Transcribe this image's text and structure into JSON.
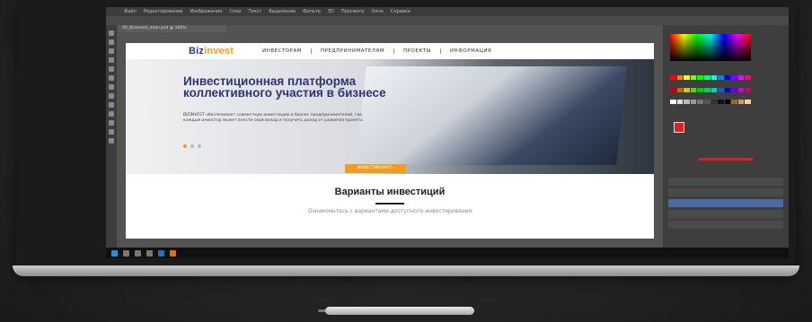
{
  "photoshop": {
    "menu_items": [
      "Файл",
      "Редактирование",
      "Изображение",
      "Слои",
      "Текст",
      "Выделение",
      "Фильтр",
      "3D",
      "Просмотр",
      "Окно",
      "Справка"
    ],
    "doc_tab": "00_Bizinvest_main.psd @ 100%"
  },
  "website": {
    "logo_main": "Biz",
    "logo_accent": "invest",
    "nav_items": [
      "ИНВЕСТОРАМ",
      "ПРЕДПРИНИМАТЕЛЯМ",
      "ПРОЕКТЫ",
      "ИНФОРМАЦИЯ"
    ],
    "hero_title": "Инвестиционная платформа коллективного участия в бизнесе",
    "hero_text": "BIZINVEST обеспечивает совместную инвестицию в бизнес предпринимателей, где каждый инвестор может внести свой вклад и получить доход от развития проекта",
    "cta_label": "ИНВЕСТИРОВАТЬ",
    "section_title": "Варианты инвестиций",
    "section_subtitle": "Ознакомьтесь с вариантами доступного инвестирования"
  }
}
